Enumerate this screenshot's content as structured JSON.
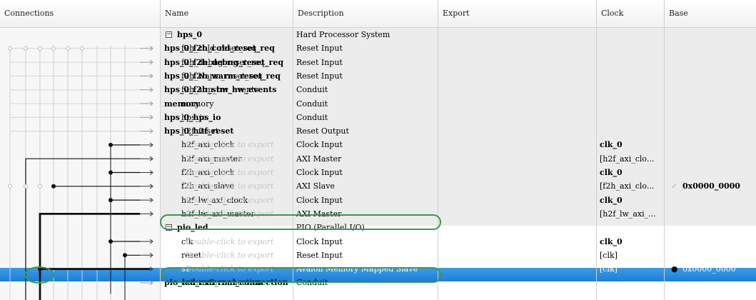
{
  "headers": {
    "connections": "Connections",
    "name": "Name",
    "description": "Description",
    "export": "Export",
    "clock": "Clock",
    "base": "Base"
  },
  "rows": [
    {
      "name": "hps_0",
      "desc": "Hard Processor System",
      "export": "",
      "clock": "",
      "base": "",
      "kind": "group"
    },
    {
      "name": "f2h_cold_reset_req",
      "desc": "Reset Input",
      "export": "hps_0_f2h_cold_reset_req",
      "clock": "",
      "base": ""
    },
    {
      "name": "f2h_debug_reset_req",
      "desc": "Reset Input",
      "export": "hps_0_f2h_debug_reset_req",
      "clock": "",
      "base": ""
    },
    {
      "name": "f2h_warm_reset_req",
      "desc": "Reset Input",
      "export": "hps_0_f2h_warm_reset_req",
      "clock": "",
      "base": ""
    },
    {
      "name": "f2h_stm_hw_events",
      "desc": "Conduit",
      "export": "hps_0_f2h_stm_hw_events",
      "clock": "",
      "base": ""
    },
    {
      "name": "memory",
      "desc": "Conduit",
      "export": "memory",
      "clock": "",
      "base": ""
    },
    {
      "name": "hps_io",
      "desc": "Conduit",
      "export": "hps_0_hps_io",
      "clock": "",
      "base": ""
    },
    {
      "name": "h2f_reset",
      "desc": "Reset Output",
      "export": "hps_0_h2f_reset",
      "clock": "",
      "base": ""
    },
    {
      "name": "h2f_axi_clock",
      "desc": "Clock Input",
      "export": "Double-click to export",
      "clock": "clk_0",
      "base": ""
    },
    {
      "name": "h2f_axi_master",
      "desc": "AXI Master",
      "export": "Double-click to export",
      "clock": "[h2f_axi_clo...",
      "base": ""
    },
    {
      "name": "f2h_axi_clock",
      "desc": "Clock Input",
      "export": "Double-click to export",
      "clock": "clk_0",
      "base": ""
    },
    {
      "name": "f2h_axi_slave",
      "desc": "AXI Slave",
      "export": "Double-click to export",
      "clock": "[f2h_axi_clo...",
      "base": "0x0000_0000"
    },
    {
      "name": "h2f_lw_axi_clock",
      "desc": "Clock Input",
      "export": "Double-click to export",
      "clock": "clk_0",
      "base": ""
    },
    {
      "name": "h2f_lw_axi_master",
      "desc": "AXI Master",
      "export": "Double-click to export",
      "clock": "[h2f_lw_axi_...",
      "base": ""
    },
    {
      "name": "pio_led",
      "desc": "PIO (Parallel I/O)",
      "export": "",
      "clock": "",
      "base": "",
      "kind": "group"
    },
    {
      "name": "clk",
      "desc": "Clock Input",
      "export": "Double-click to export",
      "clock": "clk_0",
      "base": ""
    },
    {
      "name": "reset",
      "desc": "Reset Input",
      "export": "Double-click to export",
      "clock": "[clk]",
      "base": ""
    },
    {
      "name": "s1",
      "desc": "Avalon Memory Mapped Slave",
      "export": "Double-click to export",
      "clock": "[clk]",
      "base": "0x0000_0000"
    },
    {
      "name": "external_connection",
      "desc": "Conduit",
      "export": "pio_led_external_connection",
      "clock": "",
      "base": ""
    }
  ],
  "colors": {
    "selection": "#1f7dd3",
    "highlight_ring": "#3a9a4a",
    "group_bg": "#ececec"
  }
}
